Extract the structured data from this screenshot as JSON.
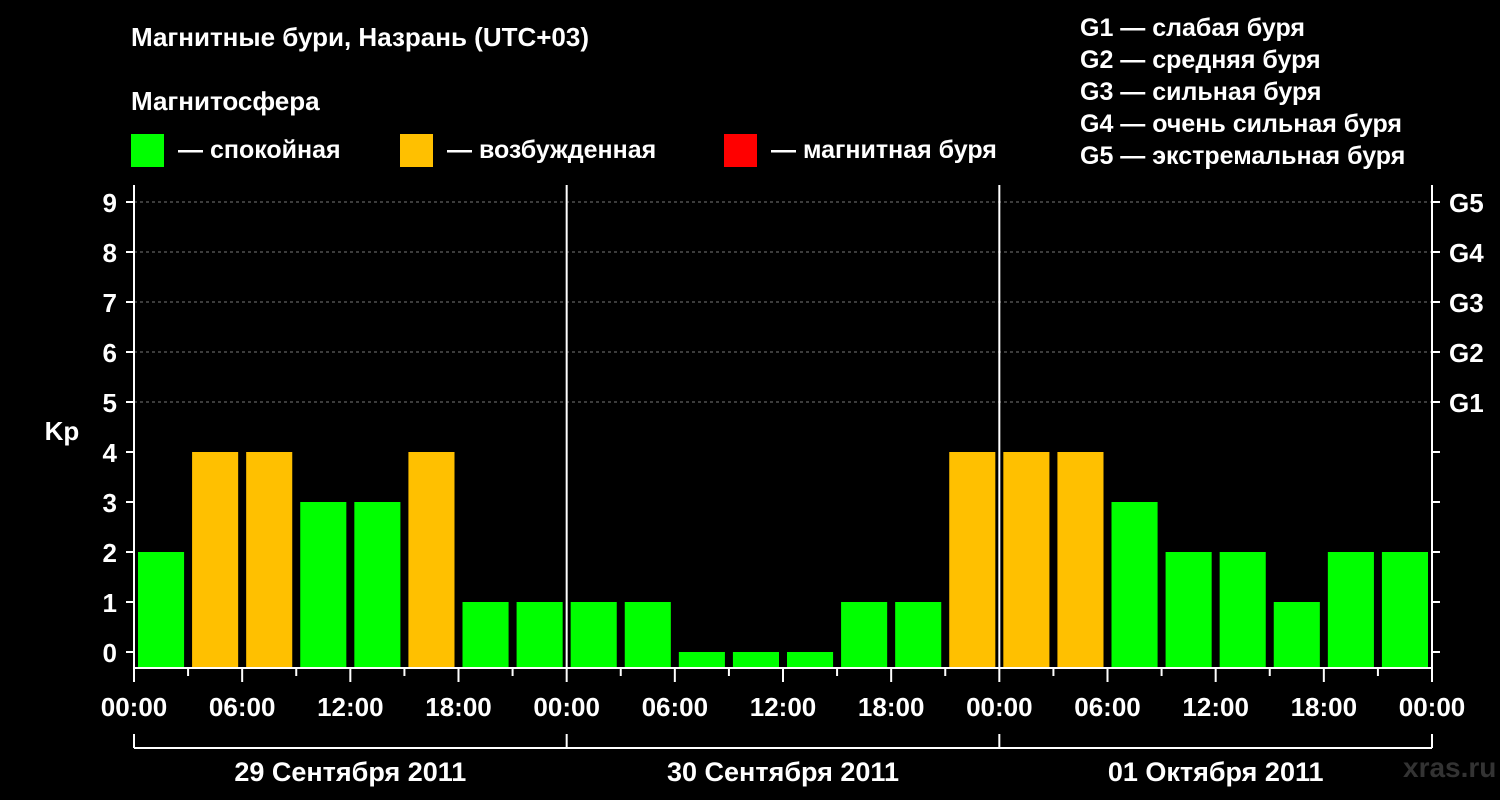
{
  "header": {
    "title": "Магнитные бури, Назрань (UTC+03)",
    "subtitle": "Магнитосфера"
  },
  "legend": {
    "items": [
      {
        "label": "— спокойная",
        "color": "#00ff00"
      },
      {
        "label": "— возбужденная",
        "color": "#ffc000"
      },
      {
        "label": "— магнитная буря",
        "color": "#ff0000"
      }
    ]
  },
  "g_legend": [
    "G1 — слабая буря",
    "G2 — средняя буря",
    "G3 — сильная буря",
    "G4 — очень сильная буря",
    "G5 — экстремальная буря"
  ],
  "watermark": "xras.ru",
  "chart_data": {
    "type": "bar",
    "title": "Магнитные бури, Назрань (UTC+03)",
    "ylabel": "Kp",
    "ylim": [
      0,
      9
    ],
    "y_ticks": [
      "0",
      "1",
      "2",
      "3",
      "4",
      "5",
      "6",
      "7",
      "8",
      "9"
    ],
    "right_ticks": [
      {
        "value": 5,
        "label": "G1"
      },
      {
        "value": 6,
        "label": "G2"
      },
      {
        "value": 7,
        "label": "G3"
      },
      {
        "value": 8,
        "label": "G4"
      },
      {
        "value": 9,
        "label": "G5"
      }
    ],
    "x_tick_labels": [
      "00:00",
      "06:00",
      "12:00",
      "18:00",
      "00:00",
      "06:00",
      "12:00",
      "18:00",
      "00:00",
      "06:00",
      "12:00",
      "18:00",
      "00:00"
    ],
    "days": [
      "29 Сентября 2011",
      "30 Сентября 2011",
      "01 Октября 2011"
    ],
    "values": [
      2,
      4,
      4,
      3,
      3,
      4,
      1,
      1,
      1,
      1,
      0,
      0,
      0,
      1,
      1,
      4,
      4,
      4,
      3,
      2,
      2,
      1,
      2,
      2
    ],
    "colors": {
      "quiet": "#00ff00",
      "active": "#ffc000",
      "storm": "#ff0000"
    },
    "grid": "dashed horizontal at 5–9"
  }
}
